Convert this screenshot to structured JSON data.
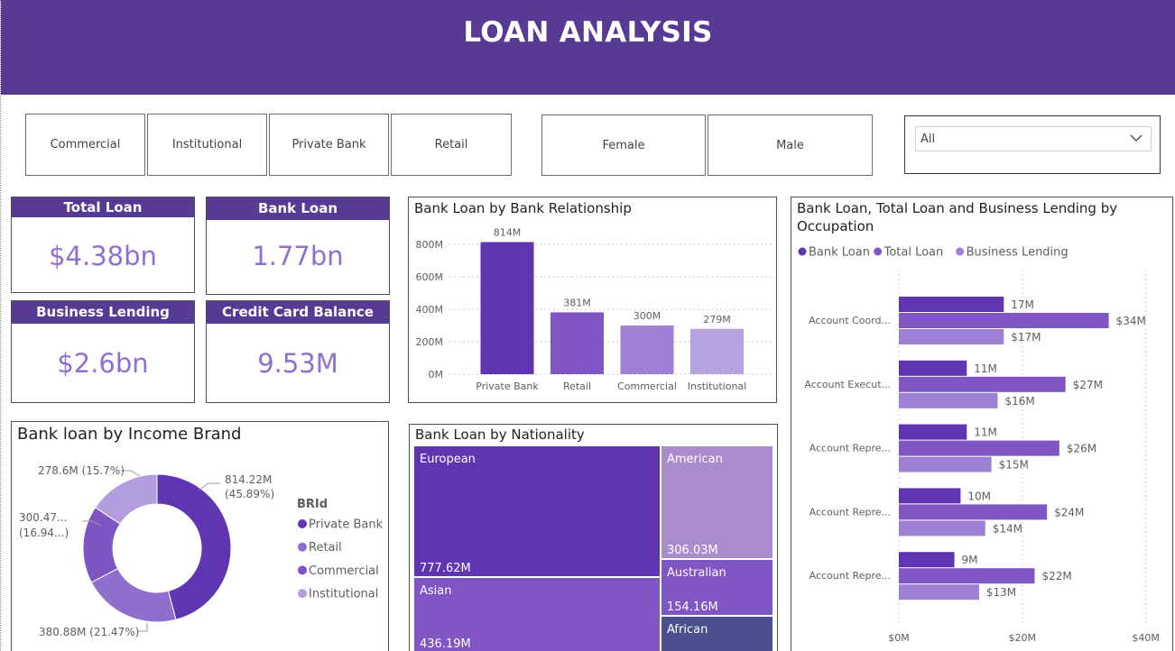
{
  "title": "LOAN ANALYSIS",
  "bank_filters": [
    "Commercial",
    "Institutional",
    "Private Bank",
    "Retail"
  ],
  "gender_filters": [
    "Female",
    "Male"
  ],
  "dropdown": {
    "selected": "All"
  },
  "kpis": {
    "total_loan": {
      "label": "Total Loan",
      "value": "$4.38bn"
    },
    "bank_loan": {
      "label": "Bank Loan",
      "value": "1.77bn"
    },
    "business_lending": {
      "label": "Business Lending",
      "value": "$2.6bn"
    },
    "credit_card_balance": {
      "label": "Credit Card Balance",
      "value": "9.53M"
    }
  },
  "colors": {
    "header": "#573a93",
    "c1": "#5f35b2",
    "c2": "#7f56c4",
    "c3": "#9e80d4",
    "c4": "#b7a1df",
    "navy": "#4a4f8d",
    "kpi": "#8f70d0"
  },
  "chart_data": [
    {
      "type": "bar",
      "title": "Bank Loan by Bank Relationship",
      "categories": [
        "Private Bank",
        "Retail",
        "Commercial",
        "Institutional"
      ],
      "values": [
        814,
        381,
        300,
        279
      ],
      "data_labels": [
        "814M",
        "381M",
        "300M",
        "279M"
      ],
      "y_ticks": [
        "0M",
        "200M",
        "400M",
        "600M",
        "800M"
      ],
      "ylim": [
        0,
        830
      ],
      "colors": [
        "#5f35b2",
        "#7f56c4",
        "#9e80d4",
        "#b7a1df"
      ],
      "grid": true
    },
    {
      "type": "bar",
      "title": "Bank Loan, Total Loan and Business Lending by Occupation",
      "orientation": "horizontal",
      "categories": [
        "Account Coord...",
        "Account Execut...",
        "Account Repre...",
        "Account Repre...",
        "Account Repre..."
      ],
      "series": [
        {
          "name": "Bank Loan",
          "values": [
            17,
            11,
            11,
            10,
            9
          ],
          "labels": [
            "17M",
            "11M",
            "11M",
            "10M",
            "9M"
          ],
          "color": "#5f35b2"
        },
        {
          "name": "Total Loan",
          "values": [
            34,
            27,
            26,
            24,
            22
          ],
          "labels": [
            "$34M",
            "$27M",
            "$26M",
            "$24M",
            "$22M"
          ],
          "color": "#7f56c4"
        },
        {
          "name": "Business Lending",
          "values": [
            17,
            16,
            15,
            14,
            13
          ],
          "labels": [
            "$17M",
            "$16M",
            "$15M",
            "$14M",
            "$13M"
          ],
          "color": "#9e80d4"
        }
      ],
      "x_ticks": [
        "$0M",
        "$20M",
        "$40M"
      ],
      "xlim": [
        0,
        40
      ],
      "legend_position": "top-left"
    },
    {
      "type": "pie",
      "title": "Bank loan by Income Brand",
      "donut": true,
      "legend_title": "BRId",
      "slices": [
        {
          "name": "Private Bank",
          "value": 814.22,
          "label_1": "814.22M",
          "label_2": "(45.89%)",
          "color": "#5f35b2"
        },
        {
          "name": "Retail",
          "value": 380.88,
          "label_1": "380.88M (21.47%)",
          "label_2": "",
          "color": "#8f6fcd"
        },
        {
          "name": "Commercial",
          "value": 300.47,
          "label_1": "300.47...",
          "label_2": "(16.94...)",
          "color": "#7d56c3"
        },
        {
          "name": "Institutional",
          "value": 278.6,
          "label_1": "278.6M (15.7%)",
          "label_2": "",
          "color": "#b39ddd"
        }
      ],
      "legend_position": "right"
    },
    {
      "type": "treemap",
      "title": "Bank Loan by Nationality",
      "items": [
        {
          "name": "European",
          "value": 777.62,
          "label": "777.62M",
          "color": "#5f35b2"
        },
        {
          "name": "Asian",
          "value": 436.19,
          "label": "436.19M",
          "color": "#7f56c4"
        },
        {
          "name": "American",
          "value": 306.03,
          "label": "306.03M",
          "color": "#a98ccb"
        },
        {
          "name": "Australian",
          "value": 154.16,
          "label": "154.16M",
          "color": "#7f56c4"
        },
        {
          "name": "African",
          "value": null,
          "label": "",
          "color": "#4a4f8d"
        }
      ]
    }
  ]
}
